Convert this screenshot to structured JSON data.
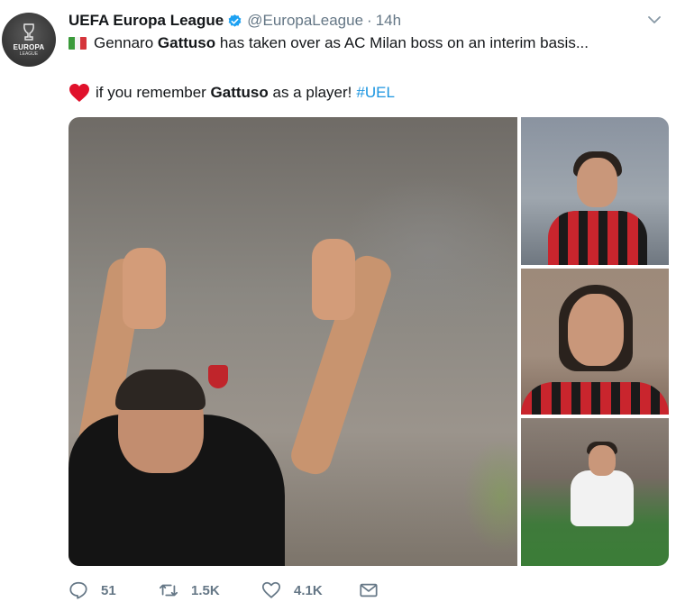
{
  "tweet": {
    "account": {
      "avatar_text_line1": "EUROPA",
      "avatar_text_line2": "LEAGUE",
      "name": "UEFA Europa League",
      "handle": "@EuropaLeague",
      "separator": "·",
      "time": "14h",
      "verified": true
    },
    "text": {
      "flag_icon": "italian-flag",
      "line1_pre": "Gennaro ",
      "line1_bold": "Gattuso",
      "line1_post": " has taken over as AC Milan boss on an interim basis...",
      "heart_icon": "red-heart",
      "line2_pre": "if you remember ",
      "line2_bold": "Gattuso",
      "line2_post": " as a player!",
      "hashtag": "#UEL"
    },
    "media": [
      "main-photo",
      "photo-2",
      "photo-3",
      "photo-4"
    ],
    "actions": {
      "reply_count": "51",
      "retweet_count": "1.5K",
      "like_count": "4.1K"
    },
    "colors": {
      "link": "#1b95e0",
      "muted": "#657786",
      "heart": "#e0245e",
      "verified": "#1da1f2"
    }
  }
}
